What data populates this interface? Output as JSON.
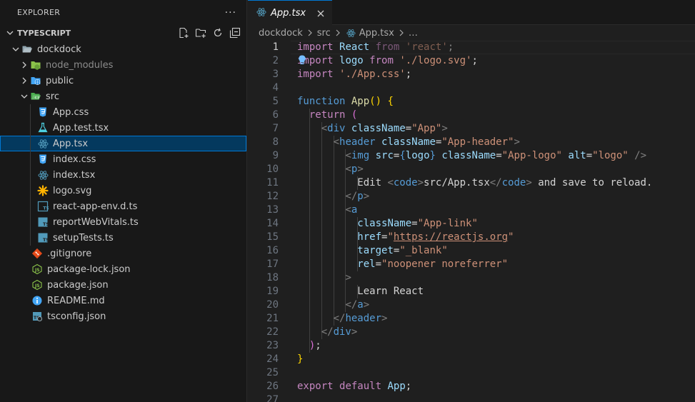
{
  "explorer": {
    "title": "EXPLORER",
    "more": "···",
    "section_title": "TYPESCRIPT"
  },
  "tree": [
    {
      "label": "dockdock",
      "kind": "folder-open",
      "depth": 1
    },
    {
      "label": "node_modules",
      "kind": "folder-node",
      "depth": 2,
      "dim": true
    },
    {
      "label": "public",
      "kind": "folder-public",
      "depth": 2
    },
    {
      "label": "src",
      "kind": "folder-src-open",
      "depth": 2
    },
    {
      "label": "App.css",
      "kind": "css",
      "depth": 3
    },
    {
      "label": "App.test.tsx",
      "kind": "test",
      "depth": 3
    },
    {
      "label": "App.tsx",
      "kind": "react",
      "depth": 3,
      "selected": true
    },
    {
      "label": "index.css",
      "kind": "css",
      "depth": 3
    },
    {
      "label": "index.tsx",
      "kind": "react",
      "depth": 3
    },
    {
      "label": "logo.svg",
      "kind": "svg",
      "depth": 3
    },
    {
      "label": "react-app-env.d.ts",
      "kind": "ts-d",
      "depth": 3
    },
    {
      "label": "reportWebVitals.ts",
      "kind": "ts",
      "depth": 3
    },
    {
      "label": "setupTests.ts",
      "kind": "ts",
      "depth": 3
    },
    {
      "label": ".gitignore",
      "kind": "git",
      "depth": 2
    },
    {
      "label": "package-lock.json",
      "kind": "json-node",
      "depth": 2
    },
    {
      "label": "package.json",
      "kind": "json-node",
      "depth": 2
    },
    {
      "label": "README.md",
      "kind": "info",
      "depth": 2
    },
    {
      "label": "tsconfig.json",
      "kind": "tsconfig",
      "depth": 2
    }
  ],
  "tab": {
    "label": "App.tsx"
  },
  "breadcrumb": {
    "parts": [
      "dockdock",
      "src",
      "App.tsx",
      "…"
    ]
  },
  "editor": {
    "active_line": 1,
    "lines": [
      [
        [
          "kw",
          "import"
        ],
        [
          "pl",
          " "
        ],
        [
          "id",
          "React"
        ],
        [
          "pl",
          " "
        ],
        [
          "kw",
          "from"
        ],
        [
          "pl",
          " "
        ],
        [
          "str",
          "'react'"
        ],
        [
          "pl",
          ";"
        ]
      ],
      [
        [
          "kw",
          "import"
        ],
        [
          "pl",
          " "
        ],
        [
          "id",
          "logo"
        ],
        [
          "pl",
          " "
        ],
        [
          "kw",
          "from"
        ],
        [
          "pl",
          " "
        ],
        [
          "str",
          "'./logo.svg'"
        ],
        [
          "pl",
          ";"
        ]
      ],
      [
        [
          "kw",
          "import"
        ],
        [
          "pl",
          " "
        ],
        [
          "str",
          "'./App.css'"
        ],
        [
          "pl",
          ";"
        ]
      ],
      [],
      [
        [
          "kwb",
          "function"
        ],
        [
          "pl",
          " "
        ],
        [
          "fn",
          "App"
        ],
        [
          "yb",
          "()"
        ],
        [
          "pl",
          " "
        ],
        [
          "yb",
          "{"
        ]
      ],
      [
        [
          "pl",
          "  "
        ],
        [
          "kw",
          "return"
        ],
        [
          "pl",
          " "
        ],
        [
          "pb",
          "("
        ]
      ],
      [
        [
          "pl",
          "    "
        ],
        [
          "br",
          "<"
        ],
        [
          "tg",
          "div"
        ],
        [
          "pl",
          " "
        ],
        [
          "id",
          "className"
        ],
        [
          "pl",
          "="
        ],
        [
          "str",
          "\"App\""
        ],
        [
          "br",
          ">"
        ]
      ],
      [
        [
          "pl",
          "      "
        ],
        [
          "br",
          "<"
        ],
        [
          "tg",
          "header"
        ],
        [
          "pl",
          " "
        ],
        [
          "id",
          "className"
        ],
        [
          "pl",
          "="
        ],
        [
          "str",
          "\"App-header\""
        ],
        [
          "br",
          ">"
        ]
      ],
      [
        [
          "pl",
          "        "
        ],
        [
          "br",
          "<"
        ],
        [
          "tg",
          "img"
        ],
        [
          "pl",
          " "
        ],
        [
          "id",
          "src"
        ],
        [
          "pl",
          "="
        ],
        [
          "kwb",
          "{"
        ],
        [
          "id",
          "logo"
        ],
        [
          "kwb",
          "}"
        ],
        [
          "pl",
          " "
        ],
        [
          "id",
          "className"
        ],
        [
          "pl",
          "="
        ],
        [
          "str",
          "\"App-logo\""
        ],
        [
          "pl",
          " "
        ],
        [
          "id",
          "alt"
        ],
        [
          "pl",
          "="
        ],
        [
          "str",
          "\"logo\""
        ],
        [
          "pl",
          " "
        ],
        [
          "br",
          "/>"
        ]
      ],
      [
        [
          "pl",
          "        "
        ],
        [
          "br",
          "<"
        ],
        [
          "tg",
          "p"
        ],
        [
          "br",
          ">"
        ]
      ],
      [
        [
          "pl",
          "          Edit "
        ],
        [
          "br",
          "<"
        ],
        [
          "tg",
          "code"
        ],
        [
          "br",
          ">"
        ],
        [
          "pl",
          "src/App.tsx"
        ],
        [
          "br",
          "</"
        ],
        [
          "tg",
          "code"
        ],
        [
          "br",
          ">"
        ],
        [
          "pl",
          " and save to reload."
        ]
      ],
      [
        [
          "pl",
          "        "
        ],
        [
          "br",
          "</"
        ],
        [
          "tg",
          "p"
        ],
        [
          "br",
          ">"
        ]
      ],
      [
        [
          "pl",
          "        "
        ],
        [
          "br",
          "<"
        ],
        [
          "tg",
          "a"
        ]
      ],
      [
        [
          "pl",
          "          "
        ],
        [
          "id",
          "className"
        ],
        [
          "pl",
          "="
        ],
        [
          "str",
          "\"App-link\""
        ]
      ],
      [
        [
          "pl",
          "          "
        ],
        [
          "id",
          "href"
        ],
        [
          "pl",
          "="
        ],
        [
          "str",
          "\""
        ],
        [
          "strlink",
          "https://reactjs.org"
        ],
        [
          "str",
          "\""
        ]
      ],
      [
        [
          "pl",
          "          "
        ],
        [
          "id",
          "target"
        ],
        [
          "pl",
          "="
        ],
        [
          "str",
          "\"_blank\""
        ]
      ],
      [
        [
          "pl",
          "          "
        ],
        [
          "id",
          "rel"
        ],
        [
          "pl",
          "="
        ],
        [
          "str",
          "\"noopener noreferrer\""
        ]
      ],
      [
        [
          "pl",
          "        "
        ],
        [
          "br",
          ">"
        ]
      ],
      [
        [
          "pl",
          "          Learn React"
        ]
      ],
      [
        [
          "pl",
          "        "
        ],
        [
          "br",
          "</"
        ],
        [
          "tg",
          "a"
        ],
        [
          "br",
          ">"
        ]
      ],
      [
        [
          "pl",
          "      "
        ],
        [
          "br",
          "</"
        ],
        [
          "tg",
          "header"
        ],
        [
          "br",
          ">"
        ]
      ],
      [
        [
          "pl",
          "    "
        ],
        [
          "br",
          "</"
        ],
        [
          "tg",
          "div"
        ],
        [
          "br",
          ">"
        ]
      ],
      [
        [
          "pl",
          "  "
        ],
        [
          "pb",
          ")"
        ],
        [
          "pl",
          ";"
        ]
      ],
      [
        [
          "yb",
          "}"
        ]
      ],
      [],
      [
        [
          "kw",
          "export"
        ],
        [
          "pl",
          " "
        ],
        [
          "kw",
          "default"
        ],
        [
          "pl",
          " "
        ],
        [
          "id",
          "App"
        ],
        [
          "pl",
          ";"
        ]
      ],
      []
    ]
  },
  "colors": {
    "accent": "#0078d4",
    "selection": "#04395e",
    "react": "#519aba",
    "css": "#42a5f5"
  }
}
